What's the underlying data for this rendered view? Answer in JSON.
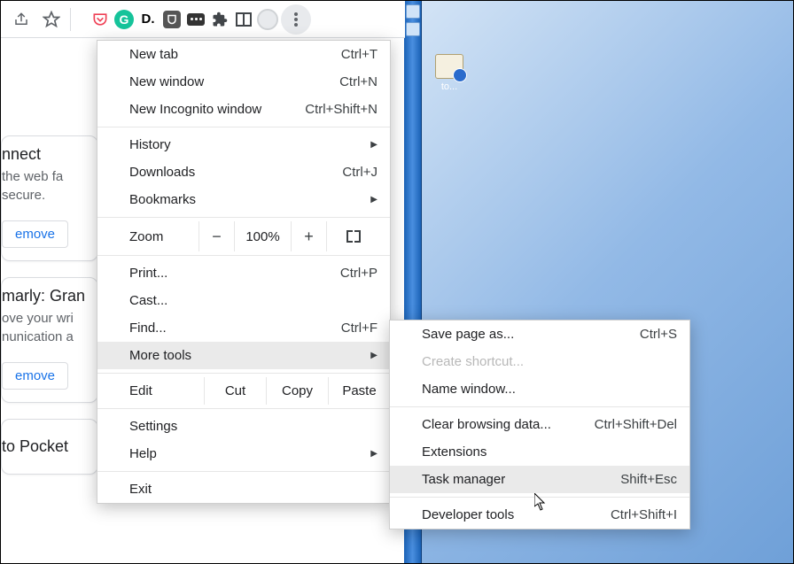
{
  "toolbar": {
    "share_icon": "share-icon",
    "star_icon": "bookmark-star-icon",
    "extensions": {
      "pocket_glyph": "◆",
      "grammarly_glyph": "G",
      "dictionary_glyph": "D.",
      "ublock_glyph": "u",
      "puzzle_glyph": "✦"
    }
  },
  "page": {
    "card1_title": "nnect",
    "card1_line1": "the web fa",
    "card1_line2": "secure.",
    "remove_label": "emove",
    "card2_title": "marly: Gran",
    "card2_line1": "ove your wri",
    "card2_line2": "nunication a",
    "card3_title": "to Pocket"
  },
  "menu": {
    "new_tab": "New tab",
    "new_tab_sc": "Ctrl+T",
    "new_window": "New window",
    "new_window_sc": "Ctrl+N",
    "new_incognito": "New Incognito window",
    "new_incognito_sc": "Ctrl+Shift+N",
    "history": "History",
    "downloads": "Downloads",
    "downloads_sc": "Ctrl+J",
    "bookmarks": "Bookmarks",
    "zoom_label": "Zoom",
    "zoom_minus": "−",
    "zoom_value": "100%",
    "zoom_plus": "+",
    "print": "Print...",
    "print_sc": "Ctrl+P",
    "cast": "Cast...",
    "find": "Find...",
    "find_sc": "Ctrl+F",
    "more_tools": "More tools",
    "edit": "Edit",
    "cut": "Cut",
    "copy": "Copy",
    "paste": "Paste",
    "settings": "Settings",
    "help": "Help",
    "exit": "Exit"
  },
  "submenu": {
    "save_as": "Save page as...",
    "save_as_sc": "Ctrl+S",
    "create_shortcut": "Create shortcut...",
    "name_window": "Name window...",
    "clear_data": "Clear browsing data...",
    "clear_data_sc": "Ctrl+Shift+Del",
    "extensions": "Extensions",
    "task_manager": "Task manager",
    "task_manager_sc": "Shift+Esc",
    "dev_tools": "Developer tools",
    "dev_tools_sc": "Ctrl+Shift+I"
  },
  "desktop_icon_label": "to..."
}
